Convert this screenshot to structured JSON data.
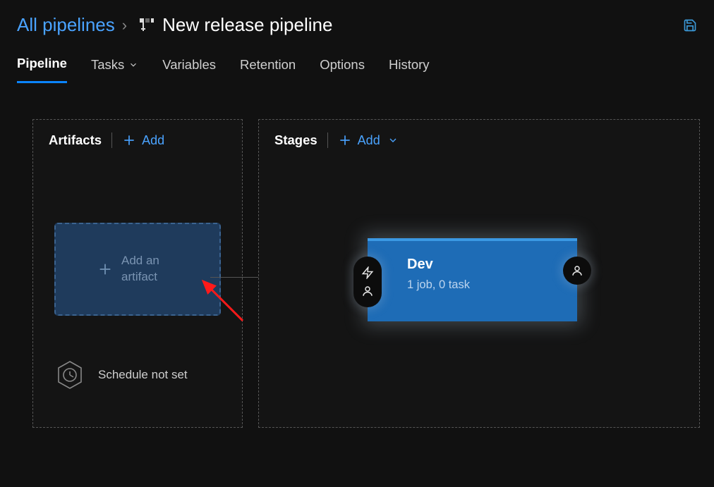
{
  "breadcrumb": {
    "root": "All pipelines",
    "title": "New release pipeline"
  },
  "tabs": {
    "pipeline": "Pipeline",
    "tasks": "Tasks",
    "variables": "Variables",
    "retention": "Retention",
    "options": "Options",
    "history": "History"
  },
  "artifacts": {
    "title": "Artifacts",
    "add_label": "Add",
    "card_text": "Add an artifact",
    "schedule_text": "Schedule not set"
  },
  "stages": {
    "title": "Stages",
    "add_label": "Add",
    "items": [
      {
        "name": "Dev",
        "subtitle": "1 job, 0 task"
      }
    ]
  }
}
